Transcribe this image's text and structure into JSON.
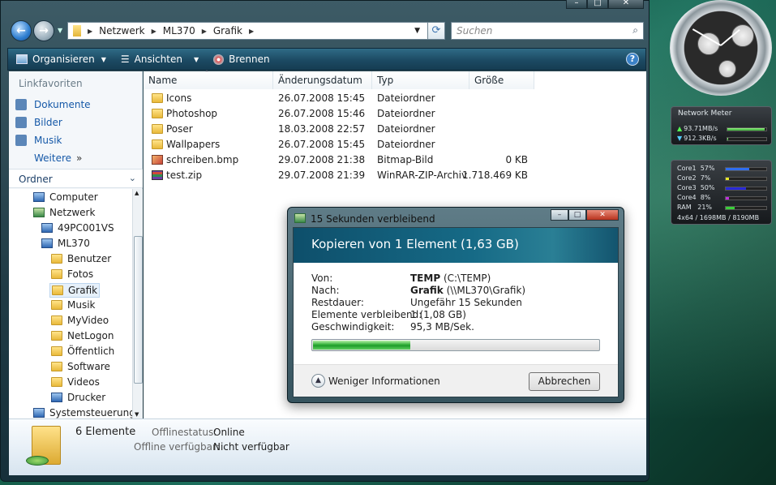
{
  "explorer": {
    "breadcrumbs": [
      "Netzwerk",
      "ML370",
      "Grafik"
    ],
    "search_placeholder": "Suchen",
    "toolbar": {
      "organize": "Organisieren",
      "views": "Ansichten",
      "burn": "Brennen"
    },
    "favorites_title": "Linkfavoriten",
    "favorites": [
      "Dokumente",
      "Bilder",
      "Musik"
    ],
    "more_label": "Weitere",
    "folders_header": "Ordner",
    "tree": [
      {
        "label": "Computer"
      },
      {
        "label": "Netzwerk"
      },
      {
        "label": "49PC001VS"
      },
      {
        "label": "ML370"
      },
      {
        "label": "Benutzer"
      },
      {
        "label": "Fotos"
      },
      {
        "label": "Grafik"
      },
      {
        "label": "Musik"
      },
      {
        "label": "MyVideo"
      },
      {
        "label": "NetLogon"
      },
      {
        "label": "Öffentlich"
      },
      {
        "label": "Software"
      },
      {
        "label": "Videos"
      },
      {
        "label": "Drucker"
      },
      {
        "label": "Systemsteuerung"
      }
    ],
    "columns": [
      "Name",
      "Änderungsdatum",
      "Typ",
      "Größe"
    ],
    "files": [
      {
        "name": "Icons",
        "date": "26.07.2008 15:45",
        "type": "Dateiordner",
        "size": ""
      },
      {
        "name": "Photoshop",
        "date": "26.07.2008 15:46",
        "type": "Dateiordner",
        "size": ""
      },
      {
        "name": "Poser",
        "date": "18.03.2008 22:57",
        "type": "Dateiordner",
        "size": ""
      },
      {
        "name": "Wallpapers",
        "date": "26.07.2008 15:45",
        "type": "Dateiordner",
        "size": ""
      },
      {
        "name": "schreiben.bmp",
        "date": "29.07.2008 21:38",
        "type": "Bitmap-Bild",
        "size": "0 KB"
      },
      {
        "name": "test.zip",
        "date": "29.07.2008 21:39",
        "type": "WinRAR-ZIP-Archiv",
        "size": "1.718.469 KB"
      }
    ],
    "details": {
      "count": "6 Elemente",
      "offline_status_label": "Offlinestatus:",
      "offline_status_value": "Online",
      "offline_avail_label": "Offline verfügbar:",
      "offline_avail_value": "Nicht verfügbar"
    }
  },
  "dialog": {
    "title": "15 Sekunden verbleibend",
    "heading": "Kopieren von 1 Element (1,63 GB)",
    "from_label": "Von:",
    "from_bold": "TEMP",
    "from_path": "(C:\\TEMP)",
    "to_label": "Nach:",
    "to_bold": "Grafik",
    "to_path": "(\\\\ML370\\Grafik)",
    "remaining_label": "Restdauer:",
    "remaining_value": "Ungefähr 15 Sekunden",
    "items_label": "Elemente verbleibend:",
    "items_value": "1 (1,08 GB)",
    "speed_label": "Geschwindigkeit:",
    "speed_value": "95,3 MB/Sek.",
    "progress": 0.34,
    "less_info": "Weniger Informationen",
    "cancel": "Abbrechen"
  },
  "gadgets": {
    "network_title": "Network Meter",
    "net_up": "93.71MB/s",
    "net_down": "912.3KB/s",
    "net_up_level": 0.95,
    "net_down_level": 0.03,
    "cores": [
      {
        "label": "Core1",
        "pct": "57%",
        "level": 0.57,
        "color": "#2f6ef0"
      },
      {
        "label": "Core2",
        "pct": "7%",
        "level": 0.07,
        "color": "#e8e82a"
      },
      {
        "label": "Core3",
        "pct": "50%",
        "level": 0.5,
        "color": "#2828d8"
      },
      {
        "label": "Core4",
        "pct": "8%",
        "level": 0.08,
        "color": "#c030e0"
      },
      {
        "label": "RAM",
        "pct": "21%",
        "level": 0.21,
        "color": "#3ad03a"
      }
    ],
    "sys_footer": "4x64 / 1698MB / 8190MB"
  },
  "colors": {
    "accent": "#1659a8",
    "progress": "#32b03a"
  }
}
